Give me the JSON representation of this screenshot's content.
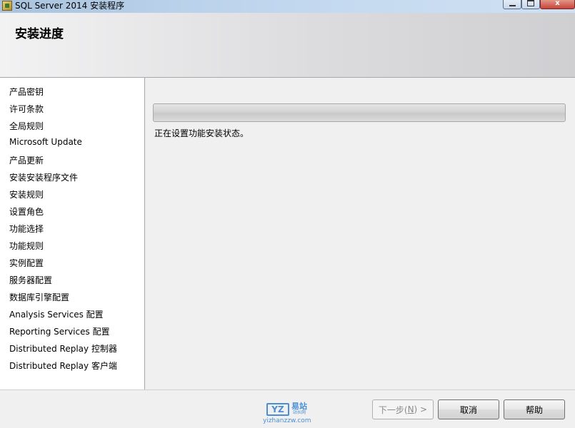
{
  "window": {
    "title": "SQL Server 2014 安装程序",
    "controls": [
      "minimize",
      "maximize",
      "close"
    ],
    "close_glyph": "x"
  },
  "header": {
    "title": "安装进度"
  },
  "sidebar": {
    "items": [
      {
        "label": "产品密钥"
      },
      {
        "label": "许可条款"
      },
      {
        "label": "全局规则"
      },
      {
        "label": "Microsoft Update"
      },
      {
        "label": "产品更新"
      },
      {
        "label": "安装安装程序文件"
      },
      {
        "label": "安装规则"
      },
      {
        "label": "设置角色"
      },
      {
        "label": "功能选择"
      },
      {
        "label": "功能规则"
      },
      {
        "label": "实例配置"
      },
      {
        "label": "服务器配置"
      },
      {
        "label": "数据库引擎配置"
      },
      {
        "label": "Analysis Services 配置"
      },
      {
        "label": "Reporting Services 配置"
      },
      {
        "label": "Distributed Replay 控制器"
      },
      {
        "label": "Distributed Replay 客户端"
      }
    ]
  },
  "main": {
    "progress_fraction": 0,
    "status": "正在设置功能安装状态。"
  },
  "footer": {
    "next_label_prefix": "下一步(",
    "next_mnemonic": "N",
    "next_label_suffix": ") >",
    "cancel_label": "取消",
    "help_label": "帮助"
  },
  "watermark": {
    "logo_text": "YZ",
    "cn_text": "易站",
    "cn_sub": "站长网",
    "url": "yizhanzzw.com"
  },
  "colors": {
    "accent": "#4a8fd6",
    "progress_track": "#d4d4d4",
    "sidebar_bg": "#ffffff",
    "window_bg": "#f0f0f0"
  }
}
